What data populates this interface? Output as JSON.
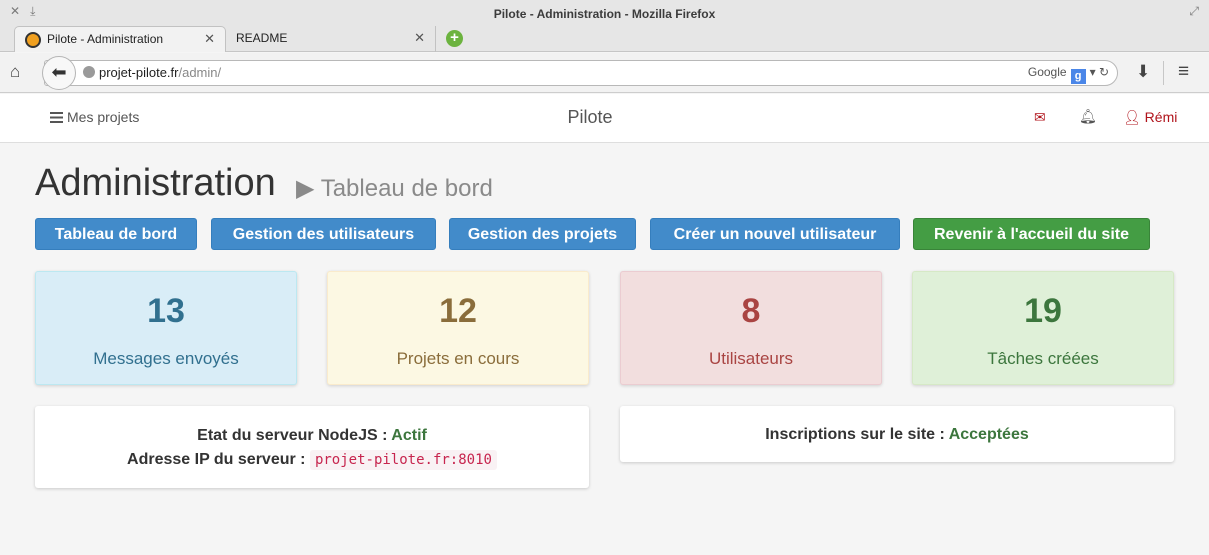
{
  "window": {
    "title": "Pilote - Administration - Mozilla Firefox"
  },
  "tabs": [
    {
      "label": "Pilote - Administration"
    },
    {
      "label": "README"
    }
  ],
  "url": {
    "host": "projet-pilote.fr",
    "path": "/admin/",
    "search_engine": "Google"
  },
  "topnav": {
    "projects": "Mes projets",
    "brand": "Pilote",
    "user": "Rémi"
  },
  "header": {
    "title": "Administration",
    "subtitle": "Tableau de bord"
  },
  "buttons": [
    {
      "label": "Tableau de bord"
    },
    {
      "label": "Gestion des utilisateurs"
    },
    {
      "label": "Gestion des projets"
    },
    {
      "label": "Créer un nouvel utilisateur"
    },
    {
      "label": "Revenir à l'accueil du site"
    }
  ],
  "stats": [
    {
      "value": "13",
      "label": "Messages envoyés",
      "color": "#31708f",
      "bg": "#d9edf7"
    },
    {
      "value": "12",
      "label": "Projets en cours",
      "color": "#8a6d3b",
      "bg": "#fcf8e3"
    },
    {
      "value": "8",
      "label": "Utilisateurs",
      "color": "#a94442",
      "bg": "#f2dede"
    },
    {
      "value": "19",
      "label": "Tâches créées",
      "color": "#3c763d",
      "bg": "#dff0d8"
    }
  ],
  "server": {
    "status_label": "Etat du serveur NodeJS :",
    "status_value": "Actif",
    "ip_label": "Adresse IP du serveur :",
    "ip_value": "projet-pilote.fr:8010"
  },
  "registration": {
    "label": "Inscriptions sur le site :",
    "value": "Acceptées"
  },
  "colors": {
    "primary": "#428bca",
    "success": "#449d44",
    "danger": "#b0131b"
  }
}
